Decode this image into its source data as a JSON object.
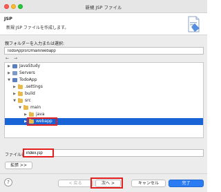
{
  "window": {
    "title": "新規 JSP ファイル"
  },
  "header": {
    "title": "JSP",
    "description": "新規 JSP ファイルを作成します。"
  },
  "folder": {
    "prompt": "親フォルダーを入力または選択:",
    "value": "TodoApp/src/main/webapp"
  },
  "toolbar": {
    "back_glyph": "←",
    "forward_glyph": "→"
  },
  "tree": {
    "items": [
      {
        "label": "JavaStudy",
        "icon": "project-icon"
      },
      {
        "label": "Servers",
        "icon": "server-folder-icon"
      },
      {
        "label": "TodoApp",
        "icon": "project-icon"
      },
      {
        "label": ".settings",
        "icon": "folder-icon"
      },
      {
        "label": "build",
        "icon": "folder-icon"
      },
      {
        "label": "src",
        "icon": "folder-icon"
      },
      {
        "label": "main",
        "icon": "folder-icon"
      },
      {
        "label": "java",
        "icon": "folder-icon"
      },
      {
        "label": "webapp",
        "icon": "folder-icon",
        "selected": true
      }
    ]
  },
  "file": {
    "label": "ファイル名:",
    "value": "index.jsp"
  },
  "buttons": {
    "advanced": "拡張 >>",
    "help": "?",
    "back": "< 戻る",
    "next": "次へ >",
    "cancel": "キャンセル",
    "finish": "完了"
  },
  "colors": {
    "selection": "#1864d6",
    "highlight": "#e41d1d",
    "primary": "#2b7cf2"
  }
}
